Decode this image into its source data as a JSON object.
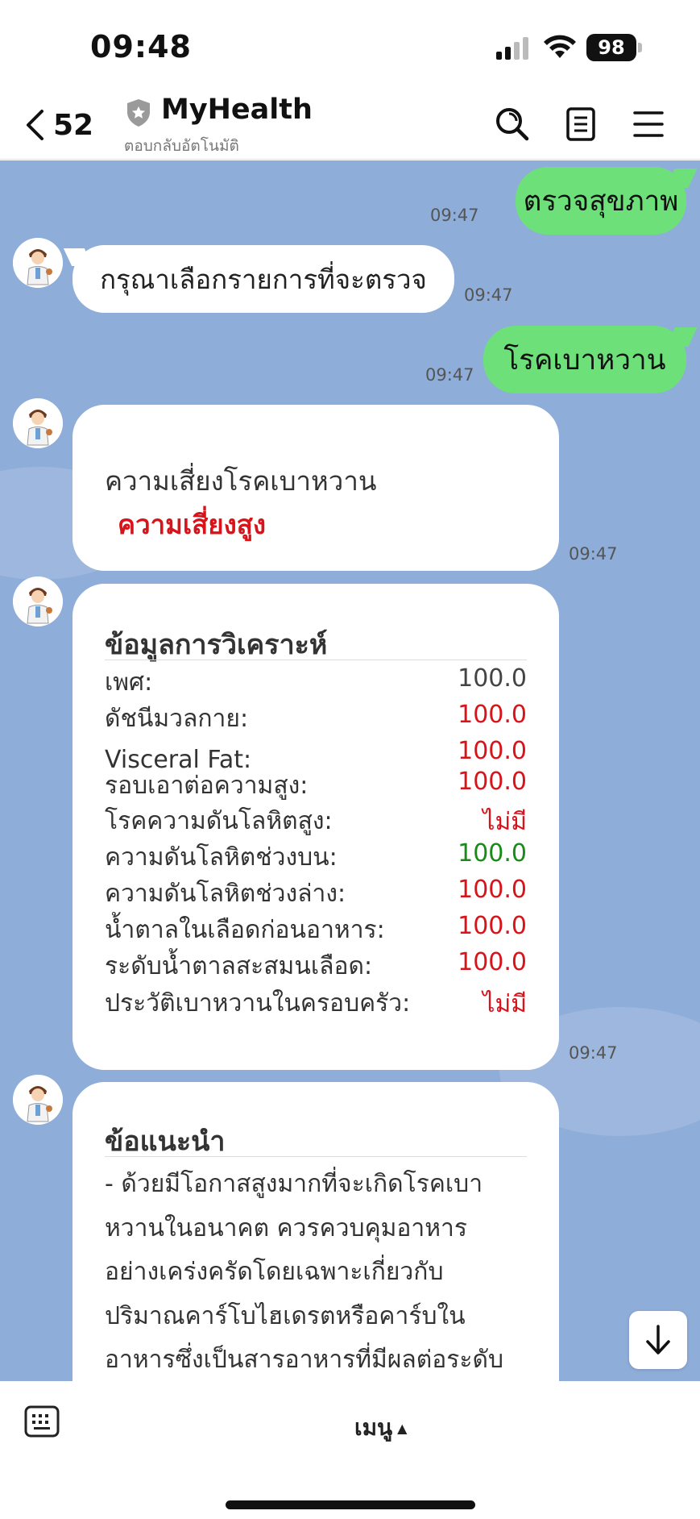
{
  "status_bar": {
    "time": "09:48",
    "battery": "98"
  },
  "header": {
    "back_count": "52",
    "title": "MyHealth",
    "subtitle": "ตอบกลับอัตโนมัติ",
    "icons": [
      "back-chevron-icon",
      "shield-icon",
      "search-icon",
      "notes-icon",
      "menu-icon"
    ]
  },
  "messages": {
    "user_1": {
      "text": "ตรวจสุขภาพ",
      "time": "09:47"
    },
    "bot_1": {
      "text": "กรุณาเลือกรายการที่จะตรวจ",
      "time": "09:47"
    },
    "user_2": {
      "text": "โรคเบาหวาน",
      "time": "09:47"
    },
    "risk_card": {
      "label": "ความเสี่ยงโรคเบาหวาน",
      "value": "ความเสี่ยงสูง",
      "time": "09:47"
    },
    "analysis_card": {
      "title": "ข้อมูลการวิเคราะห์",
      "time": "09:47",
      "rows": [
        {
          "label": "เพศ:",
          "value": "100.0",
          "color": "#444444"
        },
        {
          "label": "ดัชนีมวลกาย:",
          "value": "100.0",
          "color": "#d8141a"
        },
        {
          "label": "Visceral Fat:",
          "value": "100.0",
          "color": "#d8141a"
        },
        {
          "label": "รอบเอาต่อความสูง:",
          "value": "100.0",
          "color": "#d8141a"
        },
        {
          "label": "โรคความดันโลหิตสูง:",
          "value": "ไม่มี",
          "color": "#d8141a"
        },
        {
          "label": "ความดันโลหิตช่วงบน:",
          "value": "100.0",
          "color": "#1a8a1a"
        },
        {
          "label": "ความดันโลหิตช่วงล่าง:",
          "value": "100.0",
          "color": "#d8141a"
        },
        {
          "label": "น้ำตาลในเลือดก่อนอาหาร:",
          "value": "100.0",
          "color": "#d8141a"
        },
        {
          "label": "ระดับน้ำตาลสะสมนเลือด:",
          "value": "100.0",
          "color": "#d8141a"
        },
        {
          "label": "ประวัติเบาหวานในครอบครัว:",
          "value": "ไม่มี",
          "color": "#d8141a"
        }
      ]
    },
    "advice_card": {
      "title": "ข้อแนะนำ",
      "text": "- ด้วยมีโอกาสสูงมากที่จะเกิดโรคเบาหวานในอนาคต ควรควบคุมอาหารอย่างเคร่งครัดโดยเฉพาะเกี่ยวกับปริมาณคาร์โบไฮเดรตหรือคาร์บในอาหารซึ่งเป็นสารอาหารที่มีผลต่อระดับ"
    }
  },
  "bottom_bar": {
    "menu_label": "เมนู",
    "menu_caret": "▲"
  }
}
